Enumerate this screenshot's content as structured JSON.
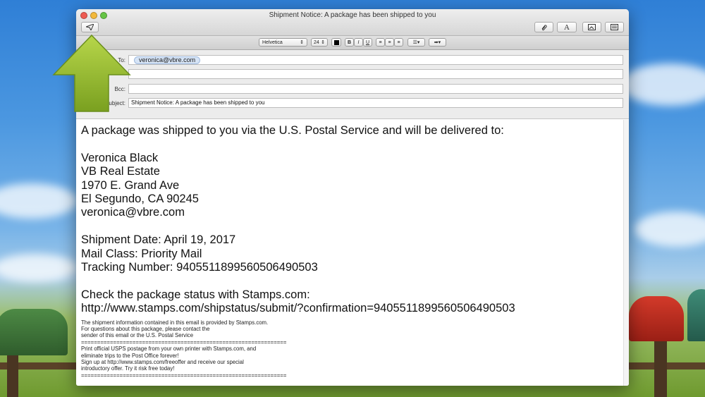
{
  "window": {
    "title": "Shipment Notice:  A package has been shipped to you"
  },
  "toolbar": {
    "send_icon": "send-icon",
    "attach_icon": "paperclip-icon",
    "fonts_label": "A",
    "photo_icon": "photo-browser-icon",
    "template_icon": "template-icon"
  },
  "format_bar": {
    "font": "Helvetica",
    "size": "24",
    "bold": "B",
    "italic": "I",
    "underline": "U"
  },
  "headers": {
    "to_label": "To:",
    "to_value": "veronica@vbre.com",
    "bcc_label": "Bcc:",
    "subject_label": "Subject:",
    "subject_value": "Shipment Notice:  A package has been shipped to you"
  },
  "message": {
    "intro": "A package was shipped to you via the U.S. Postal Service and will be delivered to:",
    "name": "Veronica Black",
    "company": "VB Real Estate",
    "street": "1970 E. Grand Ave",
    "city": "El Segundo, CA 90245",
    "email": "veronica@vbre.com",
    "shipment_date": "Shipment Date: April 19, 2017",
    "mail_class": "Mail Class: Priority Mail",
    "tracking": "Tracking Number: 9405511899560506490503",
    "status_intro": "Check the package status with Stamps.com:",
    "status_url": "http://www.stamps.com/shipstatus/submit/?confirmation=9405511899560506490503",
    "fine_1": "The shipment information contained in this email is provided by Stamps.com.",
    "fine_2": "For questions about this package, please contact the",
    "fine_3": "sender of this email or the U.S. Postal Service",
    "divider": "================================================================",
    "promo_1": "Print official USPS postage from your own printer with Stamps.com, and",
    "promo_2": "eliminate trips to the Post Office forever!",
    "promo_3": "Sign up at http://www.stamps.com/freeoffer and receive our special",
    "promo_4": "introductory offer. Try it risk free today!"
  },
  "colors": {
    "arrow": "#8db52a",
    "sky": "#3b88d8",
    "grass": "#7ea237"
  }
}
